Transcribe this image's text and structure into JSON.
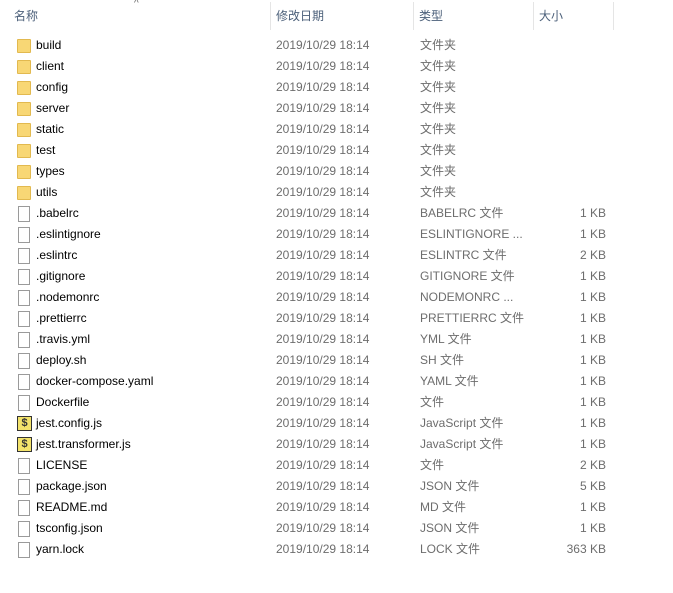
{
  "columns": {
    "name": "名称",
    "date": "修改日期",
    "type": "类型",
    "size": "大小"
  },
  "sort_indicator": "^",
  "files": [
    {
      "name": "build",
      "date": "2019/10/29 18:14",
      "type": "文件夹",
      "size": "",
      "icon": "folder-icon"
    },
    {
      "name": "client",
      "date": "2019/10/29 18:14",
      "type": "文件夹",
      "size": "",
      "icon": "folder-icon"
    },
    {
      "name": "config",
      "date": "2019/10/29 18:14",
      "type": "文件夹",
      "size": "",
      "icon": "folder-icon"
    },
    {
      "name": "server",
      "date": "2019/10/29 18:14",
      "type": "文件夹",
      "size": "",
      "icon": "folder-icon"
    },
    {
      "name": "static",
      "date": "2019/10/29 18:14",
      "type": "文件夹",
      "size": "",
      "icon": "folder-icon"
    },
    {
      "name": "test",
      "date": "2019/10/29 18:14",
      "type": "文件夹",
      "size": "",
      "icon": "folder-icon"
    },
    {
      "name": "types",
      "date": "2019/10/29 18:14",
      "type": "文件夹",
      "size": "",
      "icon": "folder-icon"
    },
    {
      "name": "utils",
      "date": "2019/10/29 18:14",
      "type": "文件夹",
      "size": "",
      "icon": "folder-icon"
    },
    {
      "name": ".babelrc",
      "date": "2019/10/29 18:14",
      "type": "BABELRC 文件",
      "size": "1 KB",
      "icon": "file-icon"
    },
    {
      "name": ".eslintignore",
      "date": "2019/10/29 18:14",
      "type": "ESLINTIGNORE ...",
      "size": "1 KB",
      "icon": "file-icon"
    },
    {
      "name": ".eslintrc",
      "date": "2019/10/29 18:14",
      "type": "ESLINTRC 文件",
      "size": "2 KB",
      "icon": "file-icon"
    },
    {
      "name": ".gitignore",
      "date": "2019/10/29 18:14",
      "type": "GITIGNORE 文件",
      "size": "1 KB",
      "icon": "file-icon"
    },
    {
      "name": ".nodemonrc",
      "date": "2019/10/29 18:14",
      "type": "NODEMONRC ...",
      "size": "1 KB",
      "icon": "file-icon"
    },
    {
      "name": ".prettierrc",
      "date": "2019/10/29 18:14",
      "type": "PRETTIERRC 文件",
      "size": "1 KB",
      "icon": "file-icon"
    },
    {
      "name": ".travis.yml",
      "date": "2019/10/29 18:14",
      "type": "YML 文件",
      "size": "1 KB",
      "icon": "file-icon"
    },
    {
      "name": "deploy.sh",
      "date": "2019/10/29 18:14",
      "type": "SH 文件",
      "size": "1 KB",
      "icon": "file-icon"
    },
    {
      "name": "docker-compose.yaml",
      "date": "2019/10/29 18:14",
      "type": "YAML 文件",
      "size": "1 KB",
      "icon": "file-icon"
    },
    {
      "name": "Dockerfile",
      "date": "2019/10/29 18:14",
      "type": "文件",
      "size": "1 KB",
      "icon": "file-icon"
    },
    {
      "name": "jest.config.js",
      "date": "2019/10/29 18:14",
      "type": "JavaScript 文件",
      "size": "1 KB",
      "icon": "js-script-icon"
    },
    {
      "name": "jest.transformer.js",
      "date": "2019/10/29 18:14",
      "type": "JavaScript 文件",
      "size": "1 KB",
      "icon": "js-script-icon"
    },
    {
      "name": "LICENSE",
      "date": "2019/10/29 18:14",
      "type": "文件",
      "size": "2 KB",
      "icon": "file-icon"
    },
    {
      "name": "package.json",
      "date": "2019/10/29 18:14",
      "type": "JSON 文件",
      "size": "5 KB",
      "icon": "file-icon"
    },
    {
      "name": "README.md",
      "date": "2019/10/29 18:14",
      "type": "MD 文件",
      "size": "1 KB",
      "icon": "file-icon"
    },
    {
      "name": "tsconfig.json",
      "date": "2019/10/29 18:14",
      "type": "JSON 文件",
      "size": "1 KB",
      "icon": "file-icon"
    },
    {
      "name": "yarn.lock",
      "date": "2019/10/29 18:14",
      "type": "LOCK 文件",
      "size": "363 KB",
      "icon": "file-icon"
    }
  ]
}
